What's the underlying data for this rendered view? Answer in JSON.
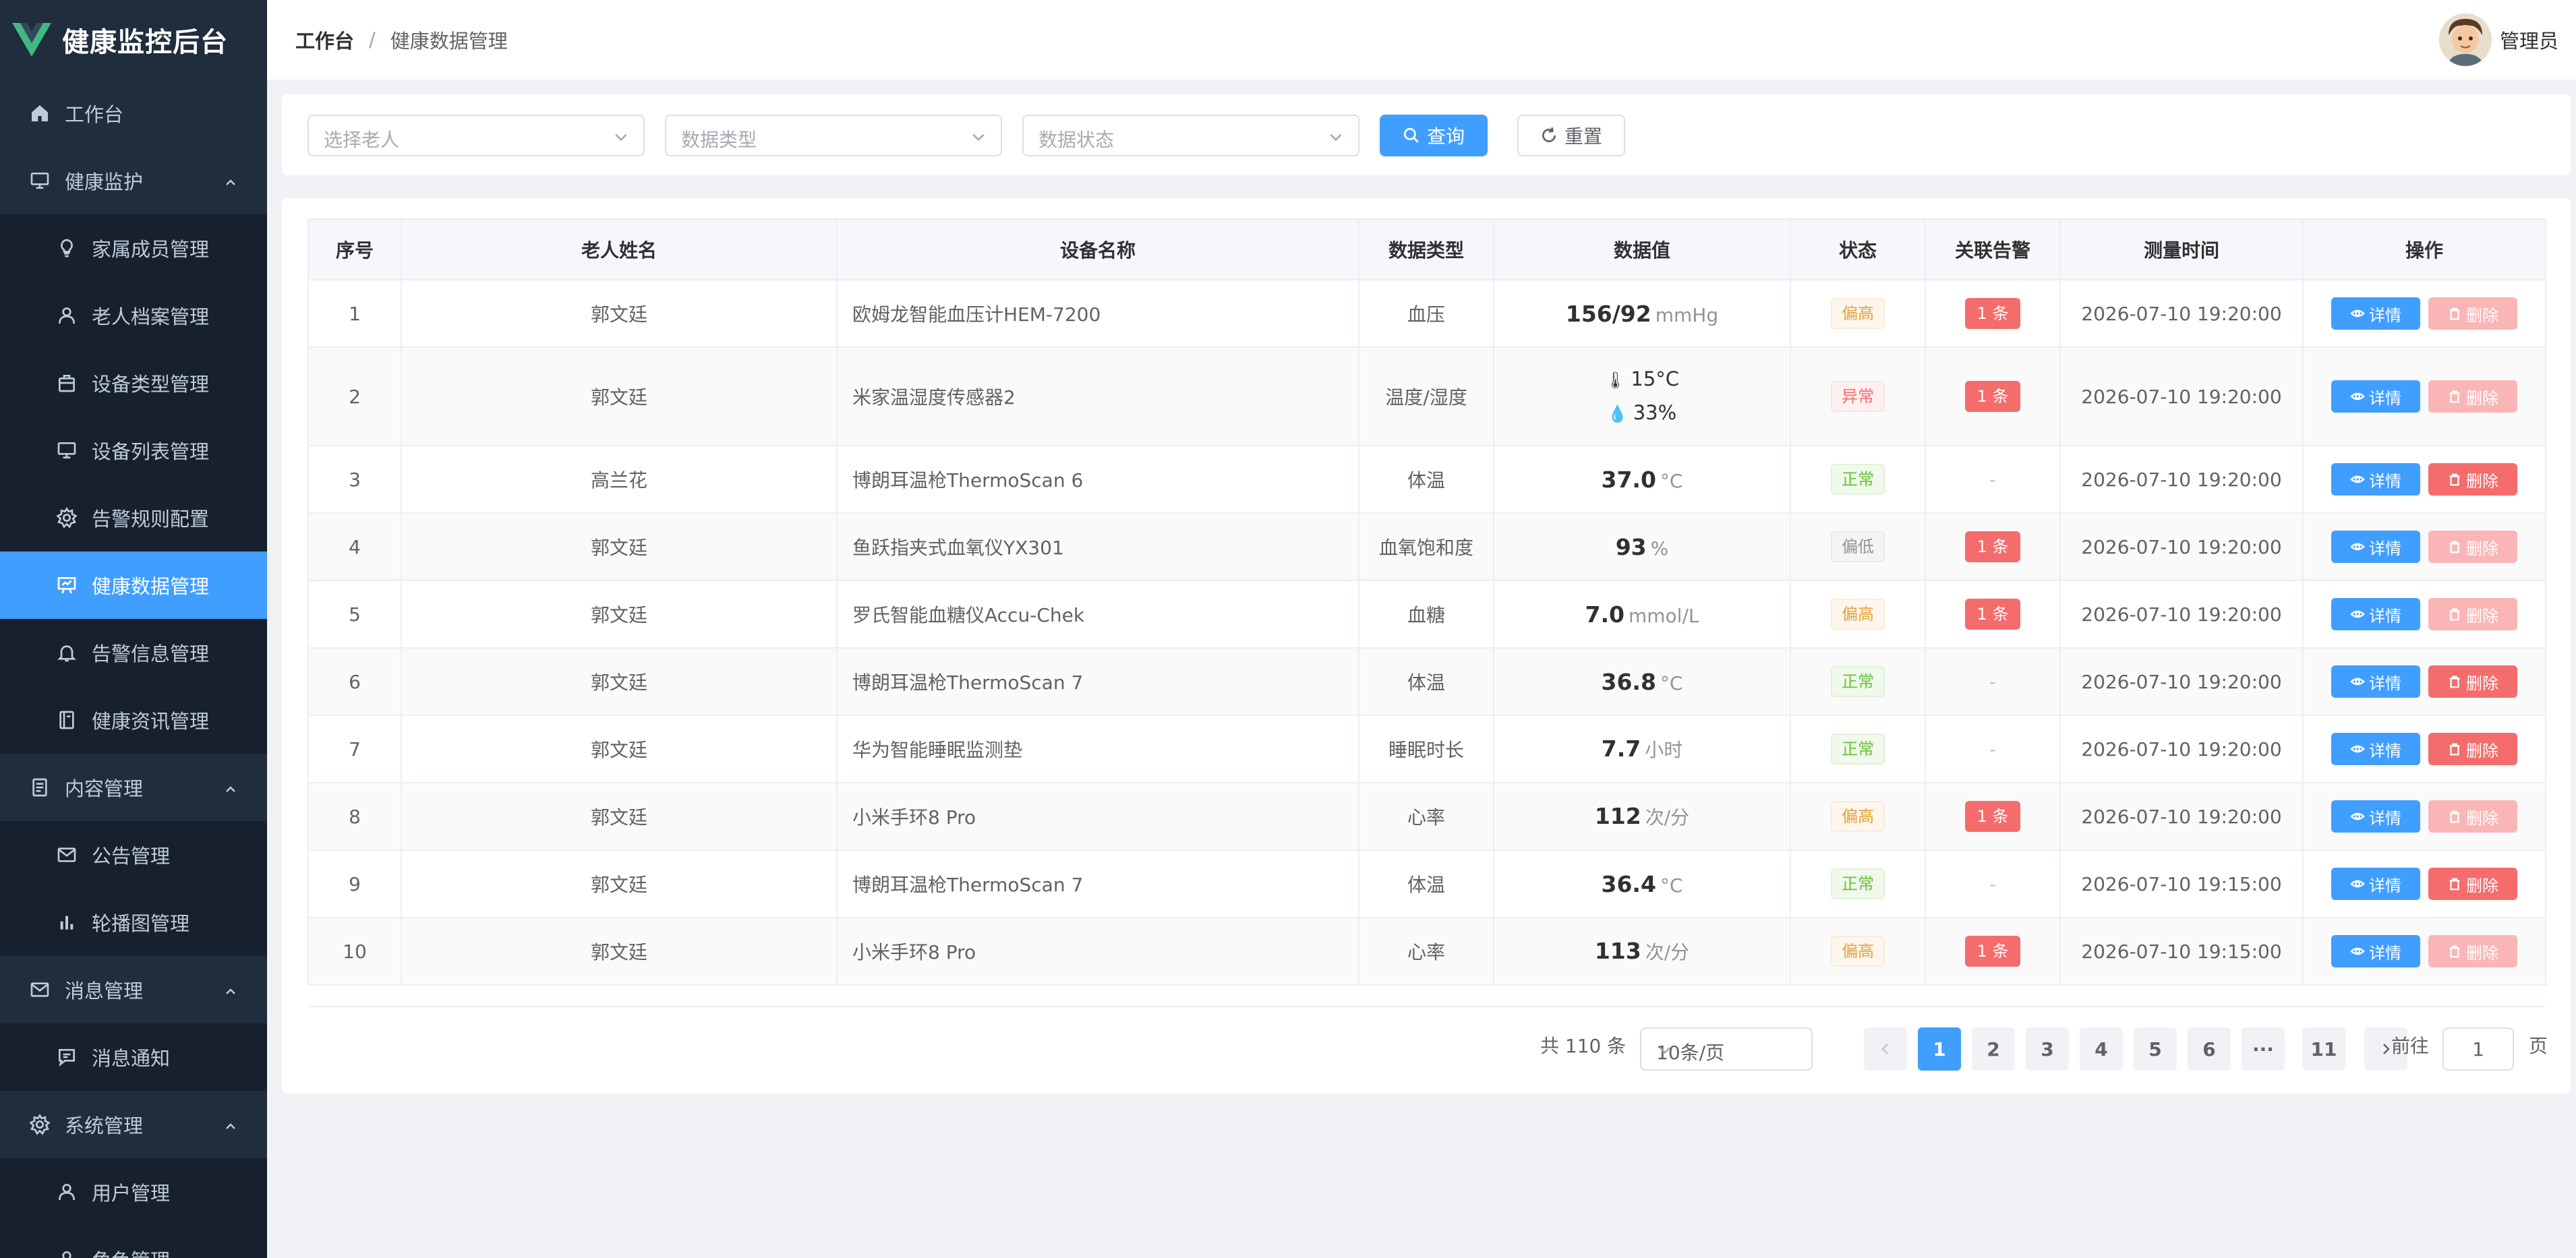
{
  "app": {
    "title": "健康监控后台"
  },
  "header": {
    "breadcrumb_home": "工作台",
    "breadcrumb_sep": "/",
    "breadcrumb_current": "健康数据管理",
    "user_name": "管理员"
  },
  "sidebar": {
    "items": [
      {
        "label": "工作台",
        "icon": "home-icon",
        "level": 1
      },
      {
        "label": "健康监护",
        "icon": "monitor-icon",
        "level": 1,
        "expanded": true
      },
      {
        "label": "家属成员管理",
        "icon": "bulb-icon",
        "level": 2
      },
      {
        "label": "老人档案管理",
        "icon": "user-icon",
        "level": 2
      },
      {
        "label": "设备类型管理",
        "icon": "box-icon",
        "level": 2
      },
      {
        "label": "设备列表管理",
        "icon": "monitor-icon",
        "level": 2
      },
      {
        "label": "告警规则配置",
        "icon": "gear-icon",
        "level": 2
      },
      {
        "label": "健康数据管理",
        "icon": "presentation-icon",
        "level": 2,
        "active": true
      },
      {
        "label": "告警信息管理",
        "icon": "bell-icon",
        "level": 2
      },
      {
        "label": "健康资讯管理",
        "icon": "notebook-icon",
        "level": 2
      },
      {
        "label": "内容管理",
        "icon": "document-icon",
        "level": 1,
        "expanded": true
      },
      {
        "label": "公告管理",
        "icon": "mail-icon",
        "level": 2
      },
      {
        "label": "轮播图管理",
        "icon": "bar-chart-icon",
        "level": 2
      },
      {
        "label": "消息管理",
        "icon": "mail-icon",
        "level": 1,
        "expanded": true
      },
      {
        "label": "消息通知",
        "icon": "message-icon",
        "level": 2
      },
      {
        "label": "系统管理",
        "icon": "gear-icon",
        "level": 1,
        "expanded": true
      },
      {
        "label": "用户管理",
        "icon": "user-icon",
        "level": 2
      },
      {
        "label": "角色管理",
        "icon": "user-icon",
        "level": 2
      }
    ]
  },
  "filters": {
    "elder_placeholder": "选择老人",
    "type_placeholder": "数据类型",
    "status_placeholder": "数据状态",
    "search_label": "查询",
    "reset_label": "重置"
  },
  "table": {
    "columns": [
      "序号",
      "老人姓名",
      "设备名称",
      "数据类型",
      "数据值",
      "状态",
      "关联告警",
      "测量时间",
      "操作"
    ],
    "detail_label": "详情",
    "delete_label": "删除",
    "rows": [
      {
        "no": "1",
        "name": "郭文廷",
        "device": "欧姆龙智能血压计HEM-7200",
        "type": "血压",
        "value": "156/92",
        "unit": "mmHg",
        "status": "偏高",
        "status_kind": "warn",
        "alarm": "1 条",
        "time": "2026-07-10 19:20:00",
        "delete_enabled": false
      },
      {
        "no": "2",
        "name": "郭文廷",
        "device": "米家温湿度传感器2",
        "type": "温度/湿度",
        "value_temp": "15°C",
        "value_hum": "33%",
        "status": "异常",
        "status_kind": "danger",
        "alarm": "1 条",
        "time": "2026-07-10 19:20:00",
        "delete_enabled": false
      },
      {
        "no": "3",
        "name": "高兰花",
        "device": "博朗耳温枪ThermoScan 6",
        "type": "体温",
        "value": "37.0",
        "unit": "°C",
        "status": "正常",
        "status_kind": "success",
        "alarm": "-",
        "time": "2026-07-10 19:20:00",
        "delete_enabled": true
      },
      {
        "no": "4",
        "name": "郭文廷",
        "device": "鱼跃指夹式血氧仪YX301",
        "type": "血氧饱和度",
        "value": "93",
        "unit": "%",
        "status": "偏低",
        "status_kind": "info",
        "alarm": "1 条",
        "time": "2026-07-10 19:20:00",
        "delete_enabled": false
      },
      {
        "no": "5",
        "name": "郭文廷",
        "device": "罗氏智能血糖仪Accu-Chek",
        "type": "血糖",
        "value": "7.0",
        "unit": "mmol/L",
        "status": "偏高",
        "status_kind": "warn",
        "alarm": "1 条",
        "time": "2026-07-10 19:20:00",
        "delete_enabled": false
      },
      {
        "no": "6",
        "name": "郭文廷",
        "device": "博朗耳温枪ThermoScan 7",
        "type": "体温",
        "value": "36.8",
        "unit": "°C",
        "status": "正常",
        "status_kind": "success",
        "alarm": "-",
        "time": "2026-07-10 19:20:00",
        "delete_enabled": true
      },
      {
        "no": "7",
        "name": "郭文廷",
        "device": "华为智能睡眠监测垫",
        "type": "睡眠时长",
        "value": "7.7",
        "unit": "小时",
        "status": "正常",
        "status_kind": "success",
        "alarm": "-",
        "time": "2026-07-10 19:20:00",
        "delete_enabled": true
      },
      {
        "no": "8",
        "name": "郭文廷",
        "device": "小米手环8 Pro",
        "type": "心率",
        "value": "112",
        "unit": "次/分",
        "status": "偏高",
        "status_kind": "warn",
        "alarm": "1 条",
        "time": "2026-07-10 19:20:00",
        "delete_enabled": false
      },
      {
        "no": "9",
        "name": "郭文廷",
        "device": "博朗耳温枪ThermoScan 7",
        "type": "体温",
        "value": "36.4",
        "unit": "°C",
        "status": "正常",
        "status_kind": "success",
        "alarm": "-",
        "time": "2026-07-10 19:15:00",
        "delete_enabled": true
      },
      {
        "no": "10",
        "name": "郭文廷",
        "device": "小米手环8 Pro",
        "type": "心率",
        "value": "113",
        "unit": "次/分",
        "status": "偏高",
        "status_kind": "warn",
        "alarm": "1 条",
        "time": "2026-07-10 19:15:00",
        "delete_enabled": false
      }
    ]
  },
  "pagination": {
    "total_text": "共 110 条",
    "page_size": "10条/页",
    "pages": [
      "1",
      "2",
      "3",
      "4",
      "5",
      "6",
      "···",
      "11"
    ],
    "current": "1",
    "goto_label": "前往",
    "goto_value": "1",
    "page_suffix": "页"
  },
  "colors": {
    "primary": "#409eff",
    "danger": "#f56c6c",
    "warning": "#e6a23c",
    "success": "#67c23a",
    "sidebar_bg": "#1f2d3d"
  }
}
